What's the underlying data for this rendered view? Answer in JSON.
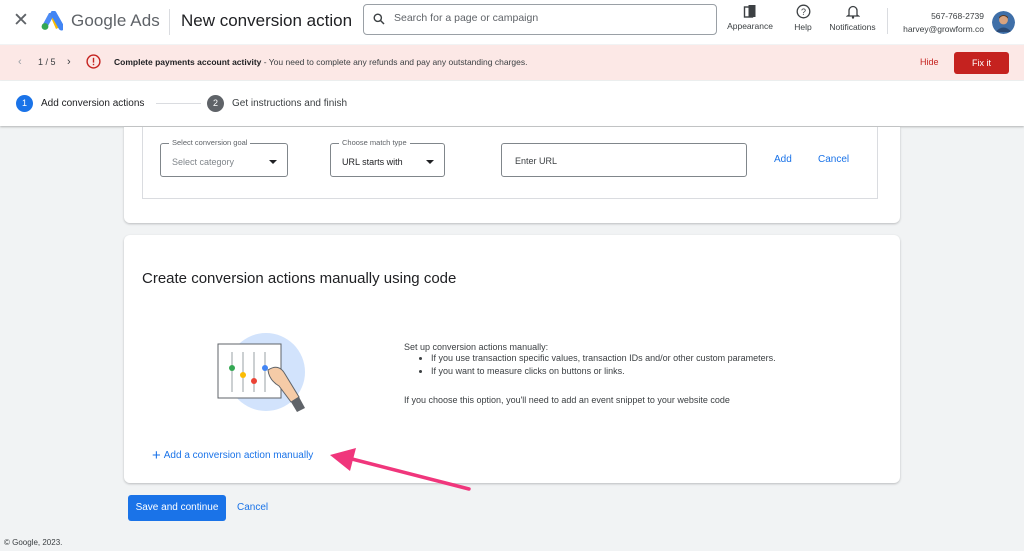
{
  "header": {
    "brand": "Google Ads",
    "page_title": "New conversion action",
    "search_placeholder": "Search for a page or campaign",
    "tools": {
      "appearance": "Appearance",
      "help": "Help",
      "notifications": "Notifications"
    },
    "account": {
      "id": "567-768-2739",
      "email": "harvey@growform.co"
    },
    "icons": [
      "close-icon",
      "google-ads-logo",
      "search-icon",
      "appearance-icon",
      "help-icon",
      "bell-icon",
      "avatar"
    ]
  },
  "alert": {
    "counter": "1 / 5",
    "title": "Complete payments account activity",
    "message": " - You need to complete any refunds and pay any outstanding charges.",
    "hide_label": "Hide",
    "fix_label": "Fix it",
    "color": "#c5221f"
  },
  "stepper": {
    "steps": [
      {
        "number": "1",
        "label": "Add conversion actions"
      },
      {
        "number": "2",
        "label": "Get instructions and finish"
      }
    ]
  },
  "url_rule": {
    "goal": {
      "label": "Select conversion goal",
      "value": "Select category"
    },
    "match": {
      "label": "Choose match type",
      "value": "URL starts with"
    },
    "url_placeholder": "Enter URL",
    "add_label": "Add",
    "cancel_label": "Cancel"
  },
  "manual_card": {
    "title": "Create conversion actions manually using code",
    "intro": "Set up conversion actions manually:",
    "bullets": [
      "If you use transaction specific values, transaction IDs and/or other custom parameters.",
      "If you want to measure clicks on buttons or links."
    ],
    "note": "If you choose this option, you'll need to add an event snippet to your website code",
    "add_label": "Add a conversion action manually"
  },
  "footer": {
    "save_label": "Save and continue",
    "cancel_label": "Cancel",
    "copyright": "© Google, 2023."
  },
  "colors": {
    "accent": "#1a73e8",
    "annotation_arrow": "#f0367c"
  }
}
